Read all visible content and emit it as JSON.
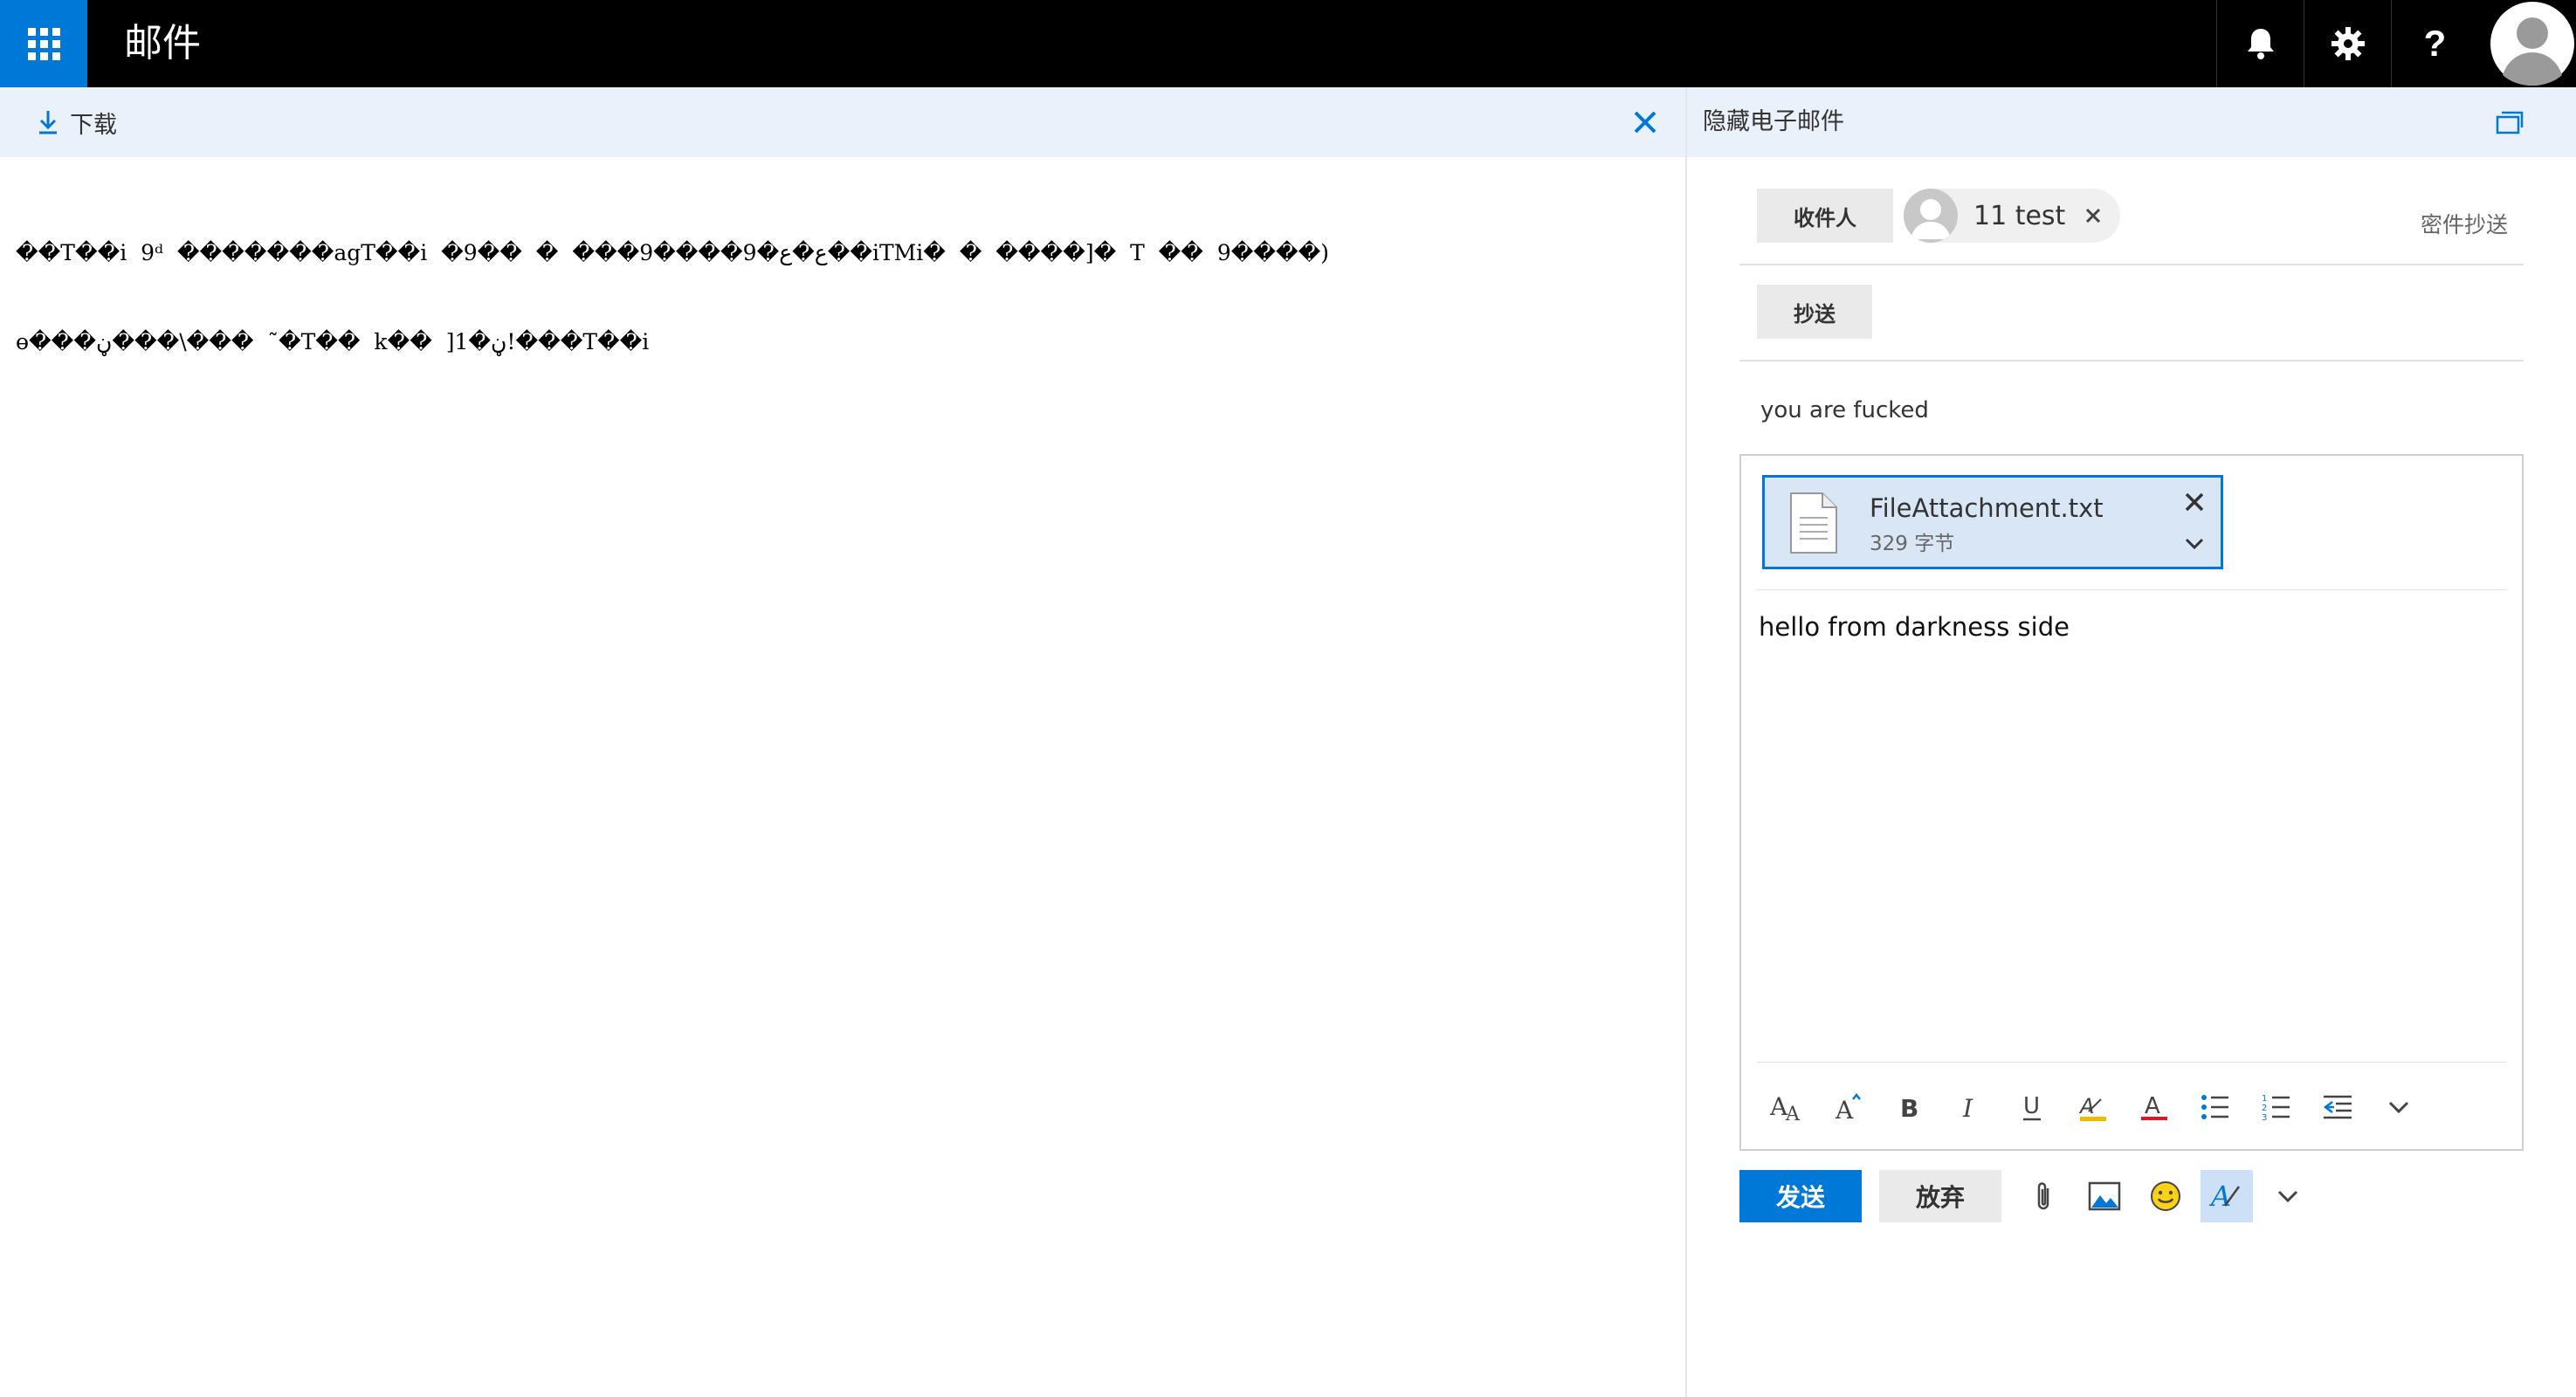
{
  "app": {
    "title": "邮件"
  },
  "preview": {
    "download_label": "下载",
    "content_lines": [
      "��T��i  9ᵈ  �������agT��i  �9��  �  ���9����9�ع�ع��iTMi�  �  ����]�  T  ��  9����)",
      "ɵ���ڼ���\\���  ˜�T��  k��  ]1�ڼ!���T��i"
    ]
  },
  "compose": {
    "hide_label": "隐藏电子邮件",
    "to_label": "收件人",
    "cc_label": "抄送",
    "bcc_label": "密件抄送",
    "recipient": {
      "name": "11 test"
    },
    "subject": "you are fucked",
    "attachment": {
      "name": "FileAttachment.txt",
      "size": "329 字节"
    },
    "body": "hello from darkness side",
    "send_label": "发送",
    "discard_label": "放弃"
  },
  "colors": {
    "accent": "#0078d7",
    "topbar": "#000000",
    "toolbar_bg": "#eaf1fa"
  }
}
